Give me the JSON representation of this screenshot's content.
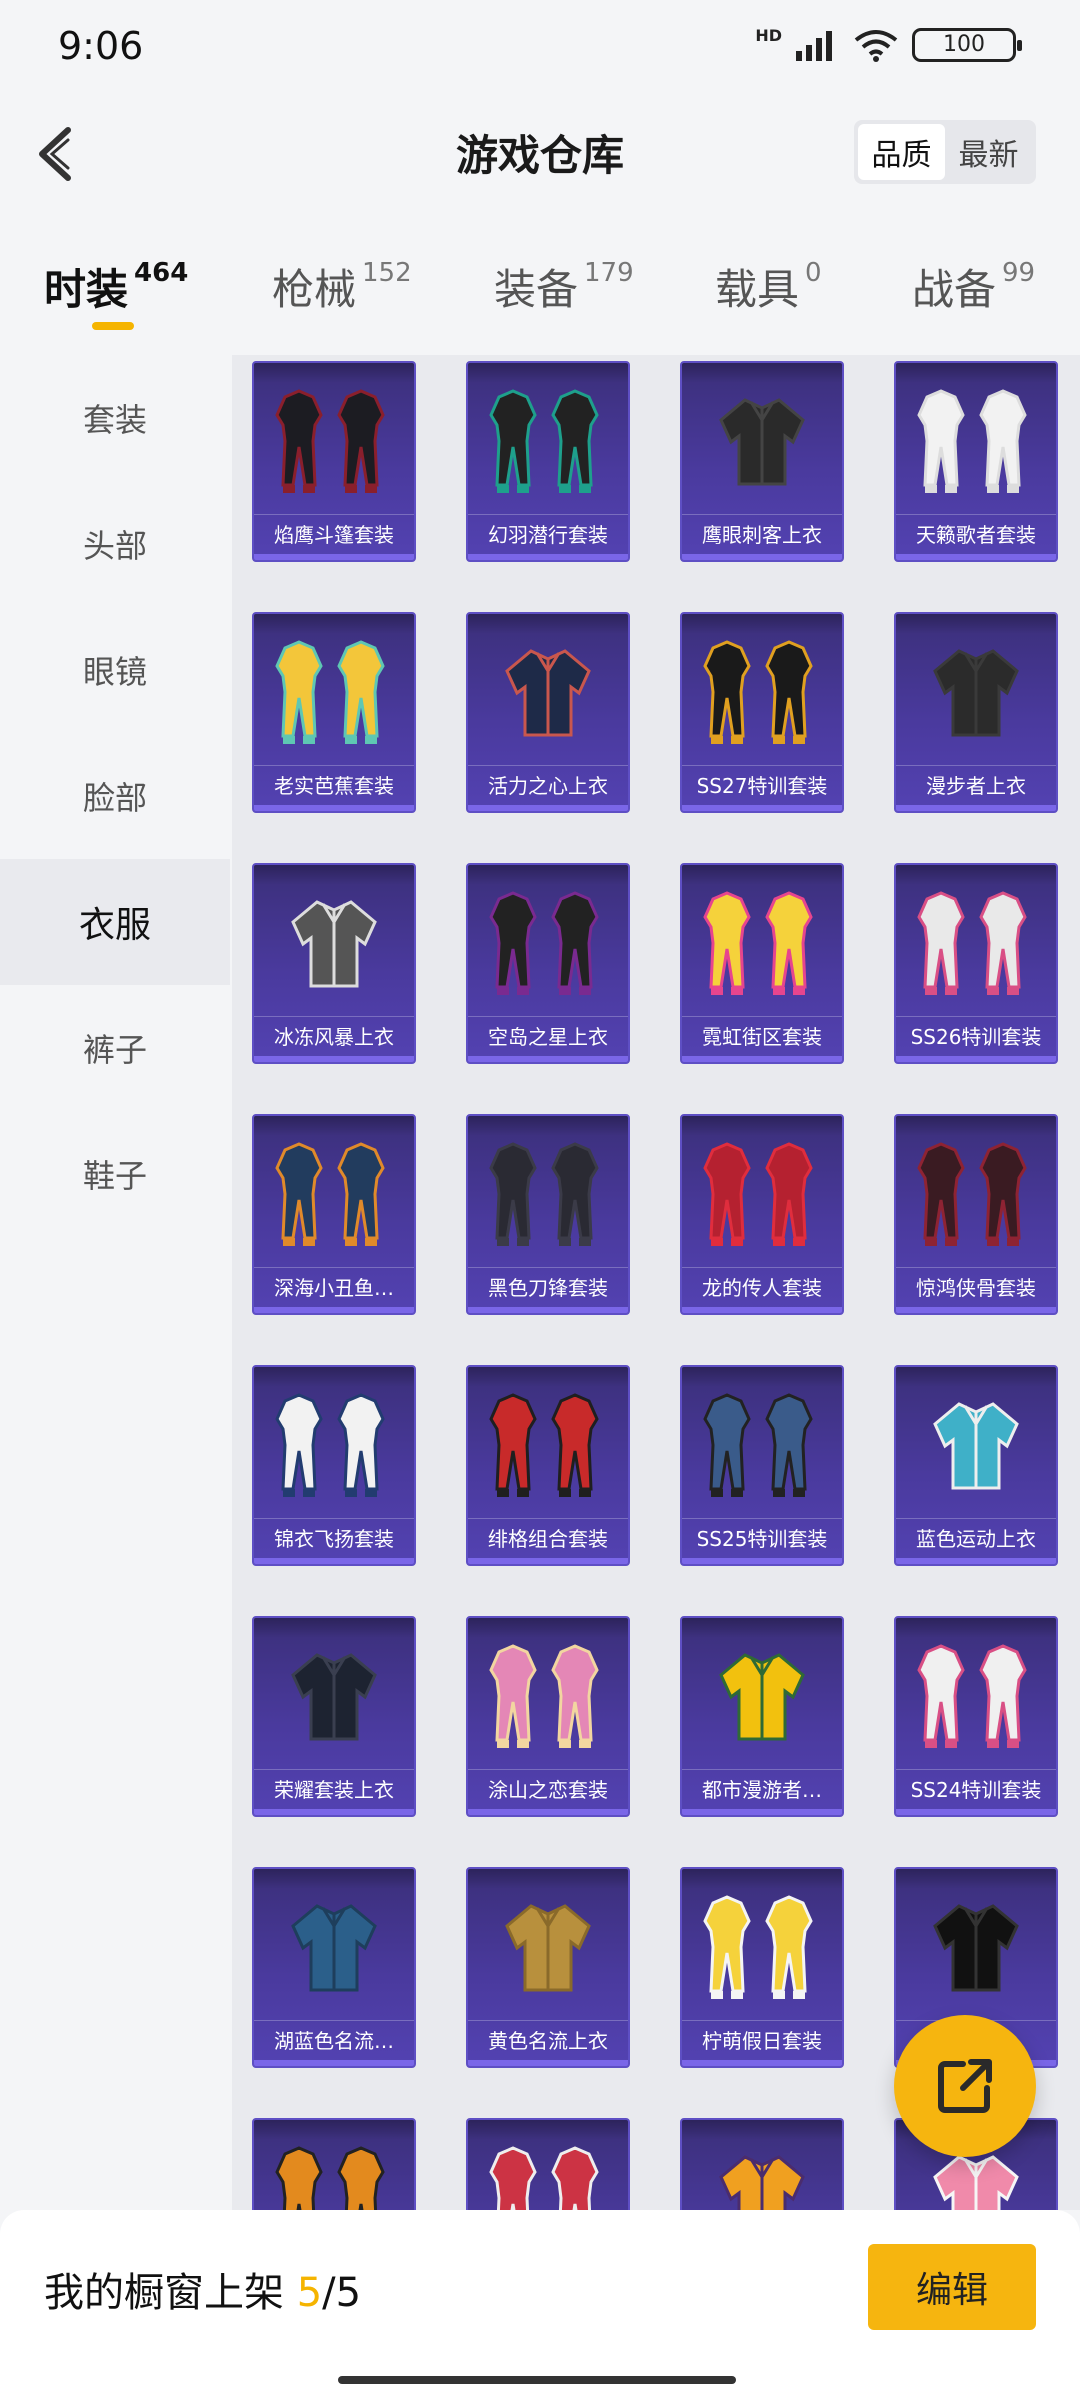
{
  "status": {
    "time": "9:06",
    "battery": "100",
    "network_badge": "HD"
  },
  "header": {
    "title": "游戏仓库",
    "sort_quality": "品质",
    "sort_latest": "最新"
  },
  "tabs": [
    {
      "label": "时装",
      "count": "464",
      "active": true
    },
    {
      "label": "枪械",
      "count": "152"
    },
    {
      "label": "装备",
      "count": "179"
    },
    {
      "label": "载具",
      "count": "0"
    },
    {
      "label": "战备",
      "count": "99"
    }
  ],
  "sidebar": {
    "items": [
      "套装",
      "头部",
      "眼镜",
      "脸部",
      "衣服",
      "裤子",
      "鞋子"
    ],
    "active": "衣服"
  },
  "items": [
    {
      "name": "焰鹰斗篷套装",
      "icon": "outfit-icon"
    },
    {
      "name": "幻羽潜行套装",
      "icon": "outfit-icon"
    },
    {
      "name": "鹰眼刺客上衣",
      "icon": "jacket-icon"
    },
    {
      "name": "天籁歌者套装",
      "icon": "outfit-icon"
    },
    {
      "name": "老实芭蕉套装",
      "icon": "outfit-icon"
    },
    {
      "name": "活力之心上衣",
      "icon": "jacket-icon"
    },
    {
      "name": "SS27特训套装",
      "icon": "outfit-icon"
    },
    {
      "name": "漫步者上衣",
      "icon": "jacket-icon"
    },
    {
      "name": "冰冻风暴上衣",
      "icon": "jacket-icon"
    },
    {
      "name": "空岛之星上衣",
      "icon": "outfit-icon"
    },
    {
      "name": "霓虹街区套装",
      "icon": "outfit-icon"
    },
    {
      "name": "SS26特训套装",
      "icon": "outfit-icon"
    },
    {
      "name": "深海小丑鱼…",
      "icon": "outfit-icon"
    },
    {
      "name": "黑色刀锋套装",
      "icon": "outfit-icon"
    },
    {
      "name": "龙的传人套装",
      "icon": "outfit-icon"
    },
    {
      "name": "惊鸿侠骨套装",
      "icon": "outfit-icon"
    },
    {
      "name": "锦衣飞扬套装",
      "icon": "outfit-icon"
    },
    {
      "name": "绯格组合套装",
      "icon": "outfit-icon"
    },
    {
      "name": "SS25特训套装",
      "icon": "outfit-icon"
    },
    {
      "name": "蓝色运动上衣",
      "icon": "jacket-icon"
    },
    {
      "name": "荣耀套装上衣",
      "icon": "jacket-icon"
    },
    {
      "name": "涂山之恋套装",
      "icon": "outfit-icon"
    },
    {
      "name": "都市漫游者…",
      "icon": "jacket-icon"
    },
    {
      "name": "SS24特训套装",
      "icon": "outfit-icon"
    },
    {
      "name": "湖蓝色名流…",
      "icon": "jacket-icon"
    },
    {
      "name": "黄色名流上衣",
      "icon": "jacket-icon"
    },
    {
      "name": "柠萌假日套装",
      "icon": "outfit-icon"
    },
    {
      "name": "",
      "icon": "jacket-icon"
    },
    {
      "name": "",
      "icon": "outfit-icon"
    },
    {
      "name": "",
      "icon": "outfit-icon"
    },
    {
      "name": "",
      "icon": "jacket-icon"
    },
    {
      "name": "",
      "icon": "jacket-icon"
    }
  ],
  "bottom": {
    "shelf_label": "我的橱窗上架",
    "shelf_current": "5",
    "shelf_total": "/5",
    "edit_label": "编辑"
  },
  "colors": {
    "accent": "#f6b50f",
    "card_bg": "#4a3a9e",
    "card_border": "#5e4fc4"
  }
}
